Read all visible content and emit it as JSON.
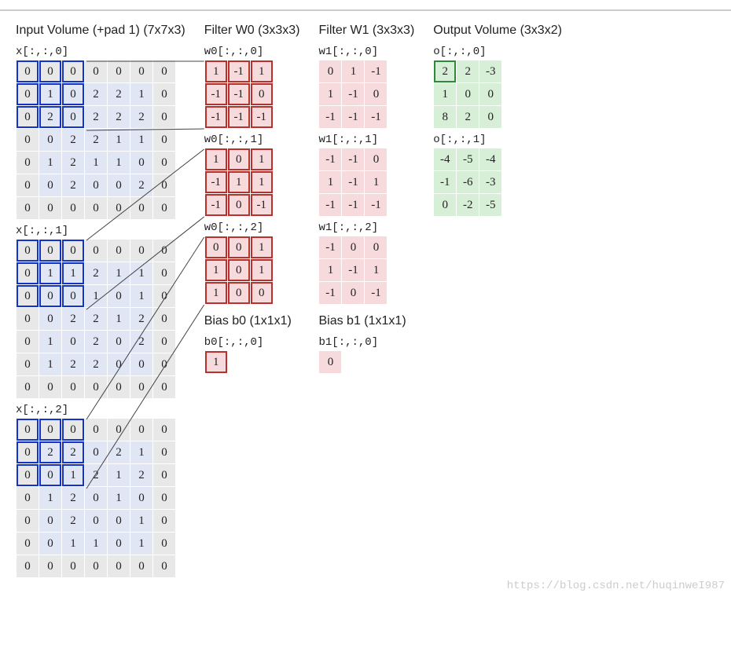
{
  "input": {
    "title": "Input Volume (+pad 1) (7x7x3)",
    "slices": [
      {
        "label": "x[:,:,0]",
        "rows": [
          [
            0,
            0,
            0,
            0,
            0,
            0,
            0
          ],
          [
            0,
            1,
            0,
            2,
            2,
            1,
            0
          ],
          [
            0,
            2,
            0,
            2,
            2,
            2,
            0
          ],
          [
            0,
            0,
            2,
            2,
            1,
            1,
            0
          ],
          [
            0,
            1,
            2,
            1,
            1,
            0,
            0
          ],
          [
            0,
            0,
            2,
            0,
            0,
            2,
            0
          ],
          [
            0,
            0,
            0,
            0,
            0,
            0,
            0
          ]
        ]
      },
      {
        "label": "x[:,:,1]",
        "rows": [
          [
            0,
            0,
            0,
            0,
            0,
            0,
            0
          ],
          [
            0,
            1,
            1,
            2,
            1,
            1,
            0
          ],
          [
            0,
            0,
            0,
            1,
            0,
            1,
            0
          ],
          [
            0,
            0,
            2,
            2,
            1,
            2,
            0
          ],
          [
            0,
            1,
            0,
            2,
            0,
            2,
            0
          ],
          [
            0,
            1,
            2,
            2,
            0,
            0,
            0
          ],
          [
            0,
            0,
            0,
            0,
            0,
            0,
            0
          ]
        ]
      },
      {
        "label": "x[:,:,2]",
        "rows": [
          [
            0,
            0,
            0,
            0,
            0,
            0,
            0
          ],
          [
            0,
            2,
            2,
            0,
            2,
            1,
            0
          ],
          [
            0,
            0,
            1,
            2,
            1,
            2,
            0
          ],
          [
            0,
            1,
            2,
            0,
            1,
            0,
            0
          ],
          [
            0,
            0,
            2,
            0,
            0,
            1,
            0
          ],
          [
            0,
            0,
            1,
            1,
            0,
            1,
            0
          ],
          [
            0,
            0,
            0,
            0,
            0,
            0,
            0
          ]
        ]
      }
    ]
  },
  "filter0": {
    "title": "Filter W0 (3x3x3)",
    "slices": [
      {
        "label": "w0[:,:,0]",
        "rows": [
          [
            1,
            -1,
            1
          ],
          [
            -1,
            -1,
            0
          ],
          [
            -1,
            -1,
            -1
          ]
        ]
      },
      {
        "label": "w0[:,:,1]",
        "rows": [
          [
            1,
            0,
            1
          ],
          [
            -1,
            1,
            1
          ],
          [
            -1,
            0,
            -1
          ]
        ]
      },
      {
        "label": "w0[:,:,2]",
        "rows": [
          [
            0,
            0,
            1
          ],
          [
            1,
            0,
            1
          ],
          [
            1,
            0,
            0
          ]
        ]
      }
    ],
    "bias_title": "Bias b0 (1x1x1)",
    "bias_label": "b0[:,:,0]",
    "bias": 1
  },
  "filter1": {
    "title": "Filter W1 (3x3x3)",
    "slices": [
      {
        "label": "w1[:,:,0]",
        "rows": [
          [
            0,
            1,
            -1
          ],
          [
            1,
            -1,
            0
          ],
          [
            -1,
            -1,
            -1
          ]
        ]
      },
      {
        "label": "w1[:,:,1]",
        "rows": [
          [
            -1,
            -1,
            0
          ],
          [
            1,
            -1,
            1
          ],
          [
            -1,
            -1,
            -1
          ]
        ]
      },
      {
        "label": "w1[:,:,2]",
        "rows": [
          [
            -1,
            0,
            0
          ],
          [
            1,
            -1,
            1
          ],
          [
            -1,
            0,
            -1
          ]
        ]
      }
    ],
    "bias_title": "Bias b1 (1x1x1)",
    "bias_label": "b1[:,:,0]",
    "bias": 0
  },
  "output": {
    "title": "Output Volume (3x3x2)",
    "slices": [
      {
        "label": "o[:,:,0]",
        "rows": [
          [
            2,
            2,
            -3
          ],
          [
            1,
            0,
            0
          ],
          [
            8,
            2,
            0
          ]
        ]
      },
      {
        "label": "o[:,:,1]",
        "rows": [
          [
            -4,
            -5,
            -4
          ],
          [
            -1,
            -6,
            -3
          ],
          [
            0,
            -2,
            -5
          ]
        ]
      }
    ]
  },
  "watermark": "https://blog.csdn.net/huqinweI987",
  "chart_data": {
    "type": "table",
    "description": "Convolution visualization: 7x7x3 padded input, two 3x3x3 filters with biases, producing 3x3x2 output. Top-left 3x3 receptive field of each input slice is highlighted; W0 cells highlighted; output[0,0,0]=2 highlighted.",
    "receptive_field": {
      "row": 0,
      "col": 0,
      "size": 3
    },
    "stride": 2
  }
}
